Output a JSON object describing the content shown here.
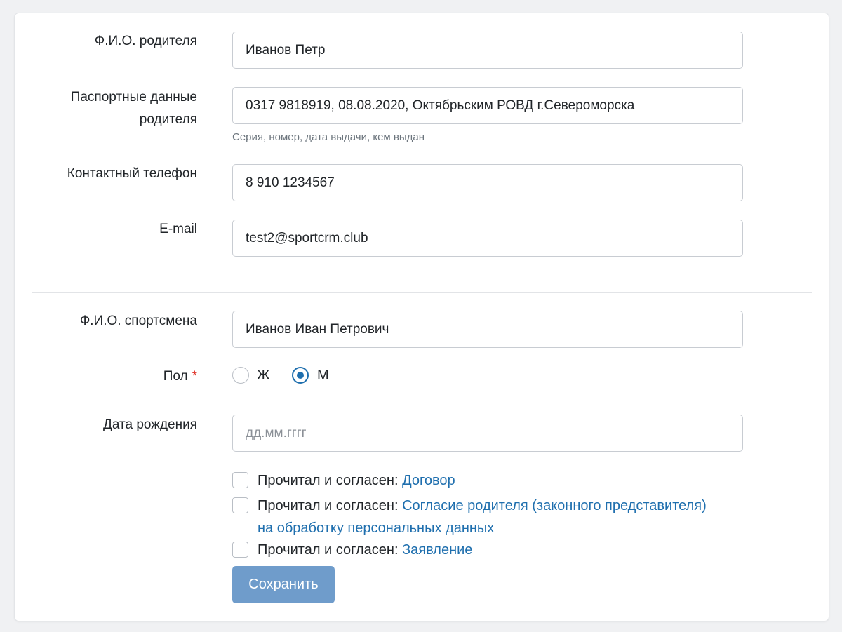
{
  "form": {
    "parent_name": {
      "label": "Ф.И.О. родителя",
      "value": "Иванов Петр"
    },
    "passport": {
      "label_line1": "Паспортные данные",
      "label_line2": "родителя",
      "value": "0317 9818919, 08.08.2020, Октябрьским РОВД г.Североморска",
      "help": "Серия, номер, дата выдачи, кем выдан"
    },
    "phone": {
      "label": "Контактный телефон",
      "value": "8 910 1234567"
    },
    "email": {
      "label": "E-mail",
      "value": "test2@sportcrm.club"
    },
    "athlete_name": {
      "label": "Ф.И.О. спортсмена",
      "value": "Иванов Иван Петрович"
    },
    "gender": {
      "label": "Пол",
      "required_mark": "*",
      "options": [
        "Ж",
        "М"
      ],
      "selected": "М"
    },
    "birth_date": {
      "label": "Дата рождения",
      "placeholder": "дд.мм.гггг",
      "value": ""
    },
    "agreements": [
      {
        "prefix": "Прочитал и согласен:",
        "link_line1": "Договор",
        "link_line2": "",
        "checked": false
      },
      {
        "prefix": "Прочитал и согласен:",
        "link_line1": "Согласие родителя (законного представителя)",
        "link_line2": "на обработку персональных данных",
        "checked": false
      },
      {
        "prefix": "Прочитал и согласен:",
        "link_line1": "Заявление",
        "link_line2": "",
        "checked": false
      }
    ],
    "save_label": "Сохранить"
  },
  "colors": {
    "accent": "#1f6fae",
    "button": "#6f9ccb",
    "required": "#e0362c",
    "background": "#f0f1f3"
  }
}
